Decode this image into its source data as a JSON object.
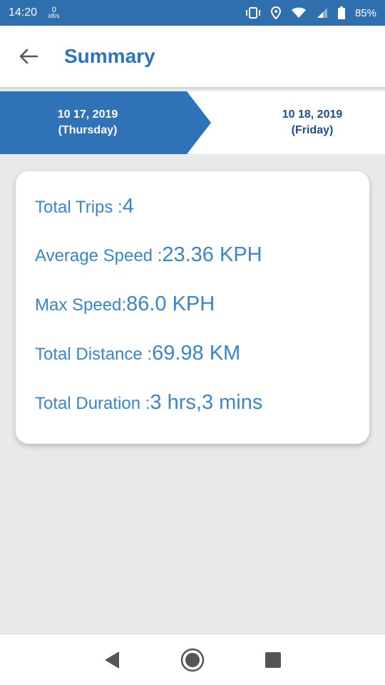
{
  "status_bar": {
    "time": "14:20",
    "net_speed_value": "0",
    "net_speed_unit": "kB/s",
    "battery": "85%"
  },
  "app_bar": {
    "title": "Summary"
  },
  "date_tabs": {
    "active": {
      "date": "10 17, 2019",
      "day": "(Thursday)"
    },
    "next": {
      "date": "10 18, 2019",
      "day": "(Friday)"
    }
  },
  "summary": {
    "total_trips_label": "Total Trips :",
    "total_trips_value": "4",
    "avg_speed_label": "Average Speed :",
    "avg_speed_value": "23.36 KPH",
    "max_speed_label": "Max Speed:",
    "max_speed_value": "86.0 KPH",
    "total_distance_label": "Total Distance :",
    "total_distance_value": "69.98 KM",
    "total_duration_label": "Total Duration :",
    "total_duration_value": "3 hrs,3 mins"
  },
  "colors": {
    "primary": "#2a75bb",
    "status_bar": "#2f6fae",
    "text_blue": "#3a86c8",
    "next_tab_text": "#1f4e8c",
    "background": "#e8e9ea"
  }
}
